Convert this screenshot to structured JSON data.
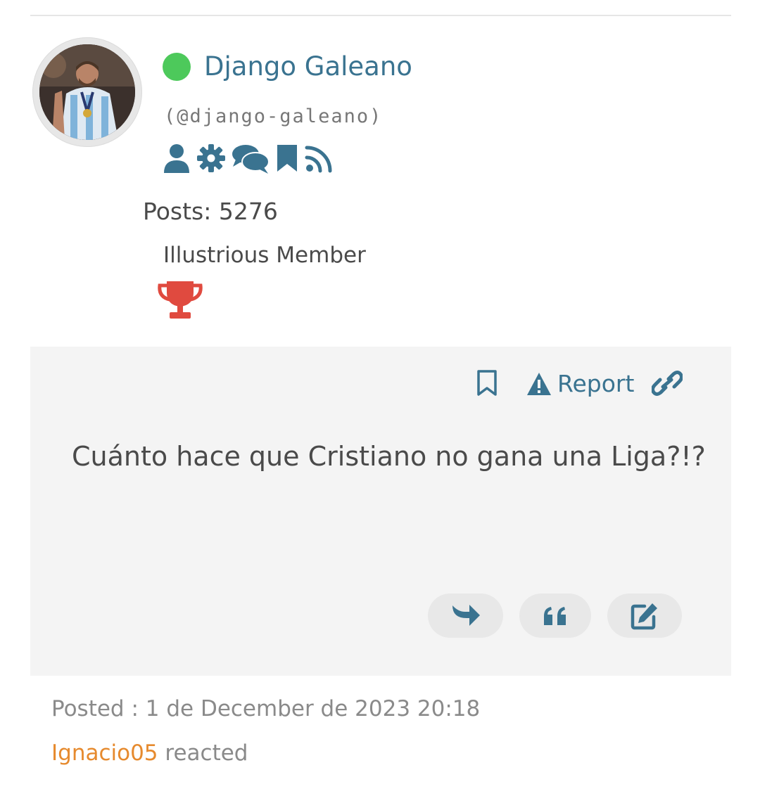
{
  "user": {
    "name": "Django Galeano",
    "handle": "(@django-galeano)",
    "online_color": "#4dc95b",
    "profile_icons": [
      "user-icon",
      "gear-icon",
      "comments-icon",
      "bookmark-icon",
      "rss-icon"
    ],
    "posts": "Posts: 5276",
    "rank": "Illustrious Member",
    "badge_icon": "trophy-icon",
    "badge_color": "#e04a3f"
  },
  "post": {
    "actions": {
      "bookmark_icon": "bookmark-outline-icon",
      "report_label": "Report",
      "link_icon": "link-icon"
    },
    "text": "Cuánto hace que Cristiano no gana una Liga?!?",
    "buttons": [
      "reply-icon",
      "quote-icon",
      "edit-icon"
    ],
    "accent_color": "#3a7390"
  },
  "footer": {
    "posted": "Posted : 1 de December de 2023 20:18",
    "reactor": "Ignacio05",
    "reacted_text": "reacted"
  }
}
